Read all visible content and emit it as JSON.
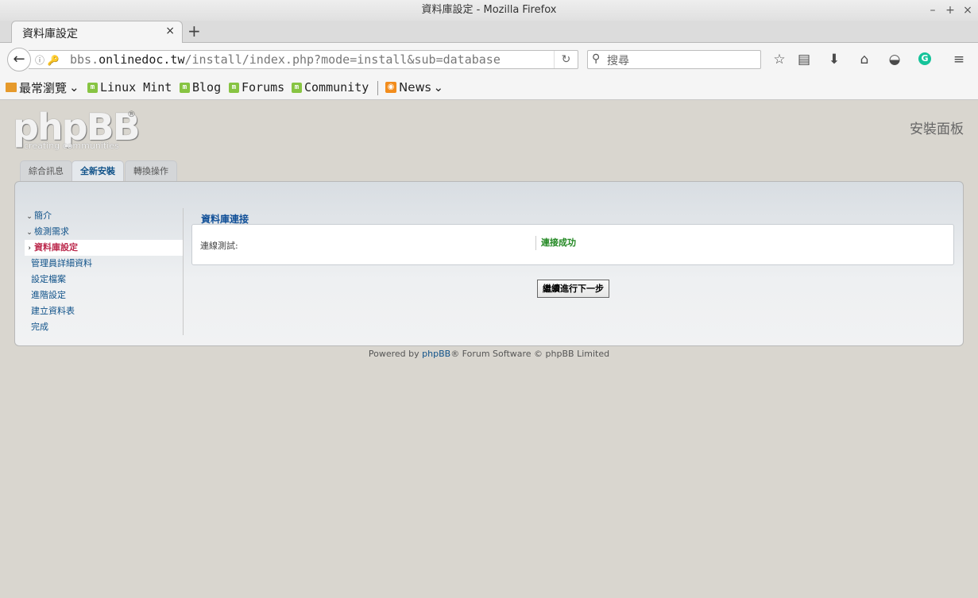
{
  "window": {
    "title": "資料庫設定 - Mozilla Firefox",
    "controls": [
      "–",
      "+",
      "×"
    ]
  },
  "tab": {
    "title": "資料庫設定",
    "close": "×",
    "new_tab": "+"
  },
  "navbar": {
    "back": "←",
    "url_scheme_prefix": "bbs.",
    "url_host": "onlinedoc.tw",
    "url_path": "/install/index.php?mode=install&sub=database",
    "reload": "↻",
    "search_placeholder": "搜尋",
    "search_icon": "🔍",
    "icons": [
      "star-icon",
      "reader-icon",
      "download-icon",
      "home-icon",
      "pocket-icon",
      "grammarly-icon",
      "menu-icon"
    ],
    "star": "☆",
    "reader": "▤",
    "download": "⬇",
    "home": "⌂",
    "pocket": "◒",
    "grammarly": "G",
    "menu": "≡"
  },
  "bookmarks": {
    "most_visited": "最常瀏覽",
    "items": [
      "Linux Mint",
      "Blog",
      "Forums",
      "Community"
    ],
    "news": "News"
  },
  "logo": {
    "main": "phpBB",
    "reg": "®",
    "sub": "creating   communities"
  },
  "panel_title": "安裝面板",
  "main_tabs": [
    "綜合訊息",
    "全新安裝",
    "轉換操作"
  ],
  "steps": {
    "items": [
      "簡介",
      "檢測需求",
      "資料庫設定",
      "管理員詳細資料",
      "設定檔案",
      "進階設定",
      "建立資料表",
      "完成"
    ]
  },
  "content": {
    "heading": "資料庫連接",
    "field_label": "連線測試:",
    "field_value": "連接成功",
    "next_button": "繼續進行下一步"
  },
  "footer": {
    "prefix": "Powered by ",
    "link": "phpBB",
    "suffix": "® Forum Software © phpBB Limited"
  },
  "colors": {
    "link": "#105289",
    "active_step": "#bc2a4d",
    "success": "#228822",
    "page_bg": "#d9d6cf"
  }
}
